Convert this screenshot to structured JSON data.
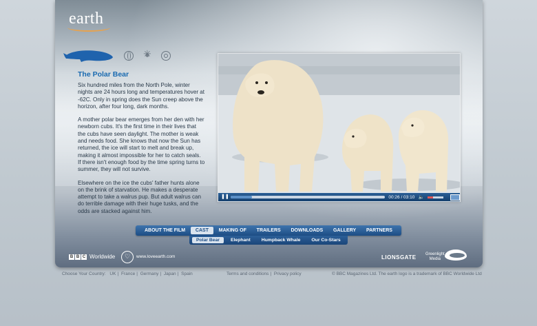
{
  "brand": {
    "logo_text": "earth"
  },
  "colors": {
    "accent": "#1a6ab0",
    "nav_bg": "#2b5f96",
    "active_bg": "#d9e3ee"
  },
  "article": {
    "title": "The Polar Bear",
    "paragraphs": [
      "Six hundred miles from the North Pole, winter nights are 24 hours long and temperatures hover at -62C. Only in spring does the Sun creep above the horizon, after four long, dark months.",
      "A mother polar bear emerges from her den with her newborn cubs. It's the first time in their lives that the cubs have seen daylight. The mother is weak and needs food. She knows that now the Sun has returned, the ice will start to melt and break up, making it almost impossible for her to catch seals. If there isn't enough food by the time spring turns to summer, they will not survive.",
      "Elsewhere on the ice the cubs' father hunts alone on the brink of starvation. He makes a desperate attempt to take a walrus pup. But adult walrus can do terrible damage with their huge tusks, and the odds are stacked against him."
    ]
  },
  "player": {
    "timecode": "00:26 / 03:10",
    "progress_fraction": 0.137,
    "volume_fraction": 0.35,
    "icons": {
      "play_pause": "pause-icon",
      "volume": "volume-icon",
      "fullscreen": "fullscreen-icon"
    }
  },
  "nav": {
    "items": [
      "ABOUT THE FILM",
      "CAST",
      "MAKING OF",
      "TRAILERS",
      "DOWNLOADS",
      "GALLERY",
      "PARTNERS"
    ],
    "active": "CAST"
  },
  "subnav": {
    "items": [
      "Polar Bear",
      "Elephant",
      "Humpback Whale",
      "Our Co-Stars"
    ],
    "active": "Polar Bear"
  },
  "partners": {
    "bbc_letters": [
      "B",
      "B",
      "C"
    ],
    "bbc_label": "Worldwide",
    "site_url": "www.loveearth.com",
    "lionsgate": "LIONSGATE",
    "greenlight_line1": "Greenlight",
    "greenlight_line2": "Media"
  },
  "footer": {
    "country_label": "Choose Your Country:",
    "countries": [
      "UK",
      "France",
      "Germany",
      "Japan",
      "Spain"
    ],
    "terms": "Terms and conditions",
    "privacy": "Privacy policy",
    "copyright": "© BBC Magazines Ltd. The earth logo is a trademark of BBC Worldwide Ltd"
  }
}
